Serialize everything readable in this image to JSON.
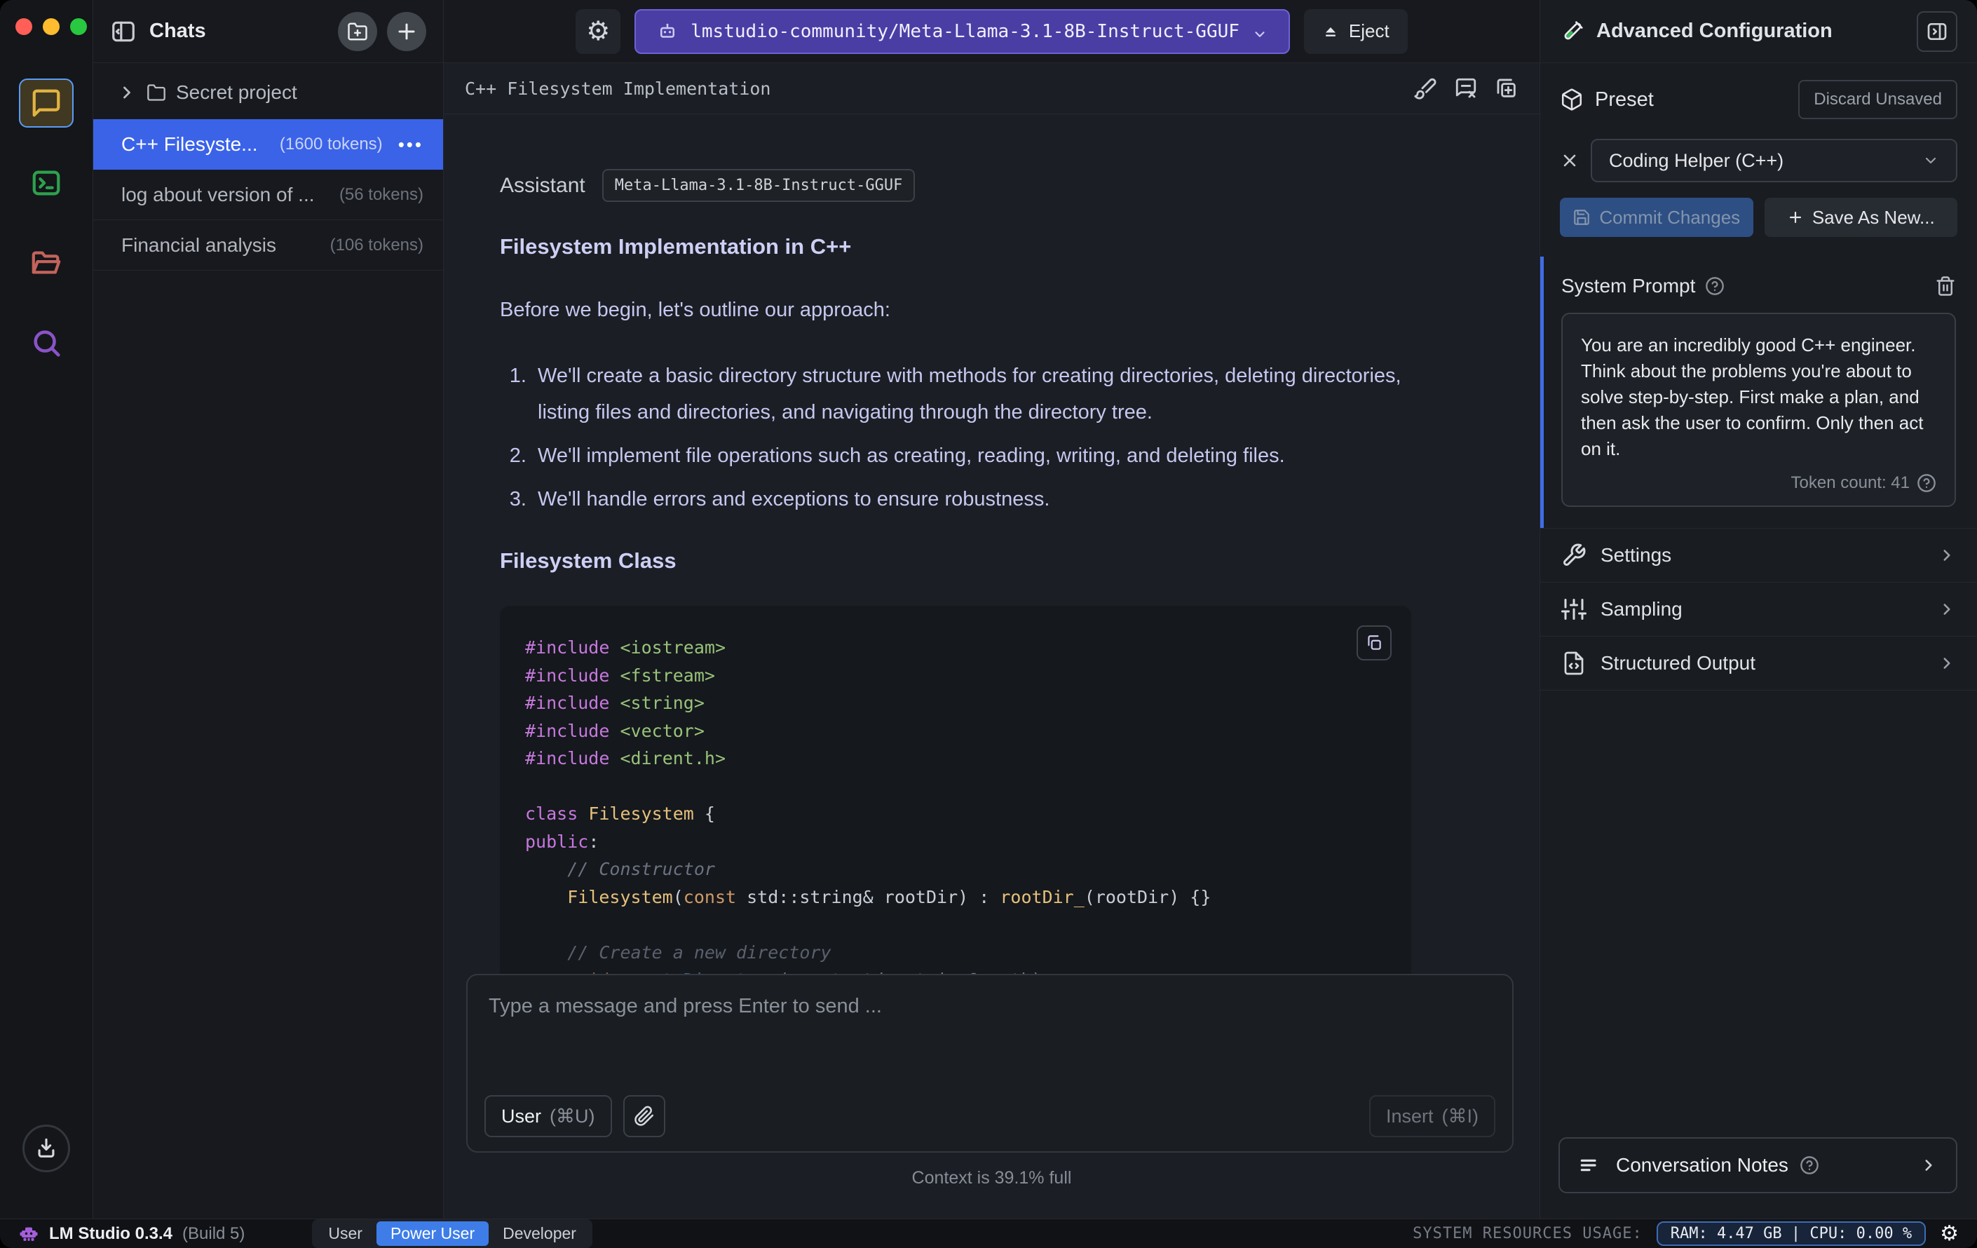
{
  "sidebar": {
    "title": "Chats",
    "tree_folder": "Secret project",
    "chats": [
      {
        "title": "C++ Filesyste...",
        "tokens": "(1600 tokens)",
        "menu": "•••"
      },
      {
        "title": "log about version of ...",
        "tokens": "(56 tokens)"
      },
      {
        "title": "Financial analysis",
        "tokens": "(106 tokens)"
      }
    ]
  },
  "topbar": {
    "model_name": "lmstudio-community/Meta-Llama-3.1-8B-Instruct-GGUF",
    "eject_label": "Eject"
  },
  "chat": {
    "title": "C++ Filesystem Implementation",
    "assistant_label": "Assistant",
    "assistant_model_badge": "Meta-Llama-3.1-8B-Instruct-GGUF",
    "heading1": "Filesystem Implementation in C++",
    "intro": "Before we begin, let's outline our approach:",
    "list": [
      "We'll create a basic directory structure with methods for creating directories, deleting directories, listing files and directories, and navigating through the directory tree.",
      "We'll implement file operations such as creating, reading, writing, and deleting files.",
      "We'll handle errors and exceptions to ensure robustness."
    ],
    "heading2": "Filesystem Class",
    "code": {
      "lines": [
        [
          {
            "t": "#include",
            "c": "kw"
          },
          {
            "t": " ",
            "c": "pl"
          },
          {
            "t": "<iostream>",
            "c": "str"
          }
        ],
        [
          {
            "t": "#include",
            "c": "kw"
          },
          {
            "t": " ",
            "c": "pl"
          },
          {
            "t": "<fstream>",
            "c": "str"
          }
        ],
        [
          {
            "t": "#include",
            "c": "kw"
          },
          {
            "t": " ",
            "c": "pl"
          },
          {
            "t": "<string>",
            "c": "str"
          }
        ],
        [
          {
            "t": "#include",
            "c": "kw"
          },
          {
            "t": " ",
            "c": "pl"
          },
          {
            "t": "<vector>",
            "c": "str"
          }
        ],
        [
          {
            "t": "#include",
            "c": "kw"
          },
          {
            "t": " ",
            "c": "pl"
          },
          {
            "t": "<dirent.h>",
            "c": "str"
          }
        ],
        [],
        [
          {
            "t": "class",
            "c": "kw"
          },
          {
            "t": " ",
            "c": "pl"
          },
          {
            "t": "Filesystem",
            "c": "type"
          },
          {
            "t": " {",
            "c": "pl"
          }
        ],
        [
          {
            "t": "public",
            "c": "kw"
          },
          {
            "t": ":",
            "c": "pl"
          }
        ],
        [
          {
            "t": "    ",
            "c": "pl"
          },
          {
            "t": "// Constructor",
            "c": "com"
          }
        ],
        [
          {
            "t": "    ",
            "c": "pl"
          },
          {
            "t": "Filesystem",
            "c": "type"
          },
          {
            "t": "(",
            "c": "pl"
          },
          {
            "t": "const",
            "c": "kw2"
          },
          {
            "t": " std::string& rootDir) : ",
            "c": "pl"
          },
          {
            "t": "rootDir_",
            "c": "type"
          },
          {
            "t": "(rootDir) {}",
            "c": "pl"
          }
        ],
        [],
        [
          {
            "t": "    ",
            "c": "pl"
          },
          {
            "t": "// Create a new directory",
            "c": "com"
          }
        ],
        [
          {
            "t": "    ",
            "c": "pl"
          },
          {
            "t": "void",
            "c": "kw2"
          },
          {
            "t": " ",
            "c": "pl"
          },
          {
            "t": "createDirectory",
            "c": "fn"
          },
          {
            "t": "(",
            "c": "pl"
          },
          {
            "t": "const",
            "c": "kw2"
          },
          {
            "t": " std::string& path);",
            "c": "pl"
          }
        ]
      ]
    },
    "input": {
      "placeholder": "Type a message and press Enter to send ...",
      "role_button": "User",
      "role_shortcut": "(⌘U)",
      "insert_label": "Insert",
      "insert_shortcut": "(⌘I)"
    },
    "context_status": "Context is 39.1% full"
  },
  "panel": {
    "title": "Advanced Configuration",
    "preset": {
      "label": "Preset",
      "discard_label": "Discard Unsaved",
      "selected": "Coding Helper (C++)",
      "commit_label": "Commit Changes",
      "save_as_label": "Save As New..."
    },
    "system_prompt": {
      "label": "System Prompt",
      "text": "You are an incredibly good C++ engineer. Think about the problems you're about to solve step-by-step. First make a plan, and then ask the user to confirm. Only then act on it.",
      "token_count": "Token count: 41"
    },
    "sections": [
      {
        "label": "Settings"
      },
      {
        "label": "Sampling"
      },
      {
        "label": "Structured Output"
      }
    ],
    "notes_label": "Conversation Notes"
  },
  "statusbar": {
    "app_name": "LM Studio 0.3.4",
    "build": "(Build 5)",
    "modes": [
      "User",
      "Power User",
      "Developer"
    ],
    "active_mode": "Power User",
    "resources_label": "SYSTEM RESOURCES USAGE:",
    "resources_value": "RAM: 4.47 GB  |  CPU: 0.00 %"
  },
  "colors": {
    "accent_blue": "#3b63e8",
    "model_pill_purple": "#4a3ea5",
    "active_mode_blue": "#3e7de8",
    "prompt_accent": "#3f6de6",
    "rail_chat_yellow": "#e3b341",
    "rail_terminal_green": "#2ea04d",
    "rail_folder_red": "#c4635c",
    "rail_search_purple": "#8a53c8",
    "invader_purple": "#a55eda"
  }
}
